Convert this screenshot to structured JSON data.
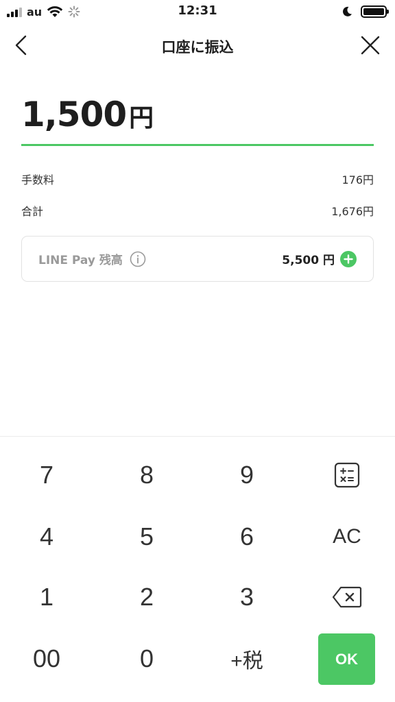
{
  "status_bar": {
    "carrier": "au",
    "time": "12:31"
  },
  "header": {
    "title": "口座に振込"
  },
  "amount": {
    "value": "1,500",
    "unit": "円"
  },
  "fee": {
    "label": "手数料",
    "value": "176円"
  },
  "total": {
    "label": "合計",
    "value": "1,676円"
  },
  "balance": {
    "label": "LINE Pay 残高",
    "value": "5,500 円"
  },
  "keypad": {
    "keys": [
      "7",
      "8",
      "9",
      "4",
      "5",
      "6",
      "AC",
      "1",
      "2",
      "3",
      "00",
      "0",
      "+税"
    ],
    "ok": "OK"
  },
  "colors": {
    "accent": "#4cc764",
    "text": "#1e1e1e",
    "muted": "#9a9a9a"
  },
  "icons": [
    "back-icon",
    "close-icon",
    "info-icon",
    "plus-circle-icon",
    "calculator-icon",
    "backspace-icon",
    "wifi-icon",
    "moon-icon",
    "battery-icon",
    "signal-icon"
  ]
}
